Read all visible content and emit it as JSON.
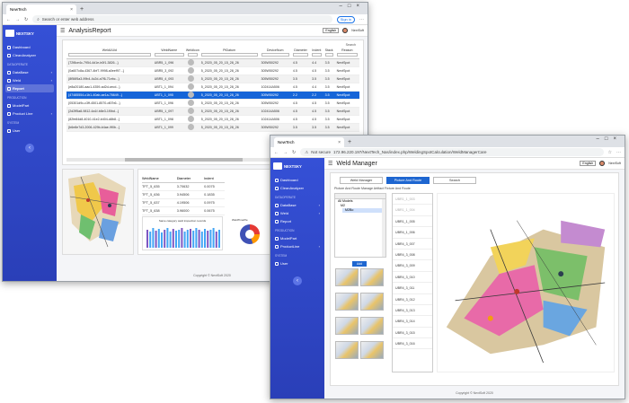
{
  "window1": {
    "tab_title": "NewTech",
    "address": "Search or enter web address",
    "signin": "Sign in",
    "logo": "NEXTSKY",
    "sidebar": {
      "items": [
        {
          "label": "Dashboard"
        },
        {
          "label": "CleanAnalyzer"
        }
      ],
      "section1": "DATAOPERATE",
      "items2": [
        {
          "label": "DataBase"
        },
        {
          "label": "Weld"
        },
        {
          "label": "Report"
        }
      ],
      "section2": "PRODUCTION",
      "items3": [
        {
          "label": "ModelPart"
        },
        {
          "label": "Product Line"
        }
      ],
      "section3": "SYSTEM",
      "items4": [
        {
          "label": "User"
        }
      ]
    },
    "page_title": "AnalysisReport",
    "lang": "English",
    "user": "NextSoft",
    "search_label": "Search",
    "table": {
      "headers": [
        "WeldUUid",
        "WeldName",
        "WeldIcon",
        "PtDatum",
        "DeviceNum",
        "Diameter",
        "Indent",
        "Stack",
        "Reason"
      ],
      "rows": [
        [
          "{72f8ce4c-7954-4d1e-b0f1-3826...}",
          "UBR5_1_096",
          "",
          "5_2020_05_20_15_28_26",
          "305W50292",
          "4.5",
          "4.4",
          "3.5",
          "NextSpot"
        ],
        [
          "{0a607c8a-4367-4bf7-9998-a0eef97...}",
          "UBR5_3_092",
          "",
          "5_2020_05_20_15_28_26",
          "305W50292",
          "4.5",
          "4.5",
          "3.5",
          "NextSpot"
        ],
        [
          "{8f56f5a3-99b4-4c2d-a7f6-71ebc...}",
          "UBR5_4_093",
          "",
          "5_2020_05_20_15_28_26",
          "305W50292",
          "3.5",
          "3.5",
          "3.5",
          "NextSpot"
        ],
        [
          "{e8a20180-aac1-4359-ad2d-cecd...}",
          "UBT1_1_094",
          "",
          "5_2020_05_20_15_28_26",
          "102414A506",
          "4.5",
          "4.4",
          "3.5",
          "NextSpot"
        ],
        [
          "{47485554-c1b1-40ab-ae1a-76649...}",
          "UBT1_1_095",
          "",
          "5_2020_05_20_15_28_26",
          "305W50292",
          "2.2",
          "2.2",
          "3.5",
          "NextSpot"
        ],
        [
          "{05301d9c-c3ff-4501-8570-d67b6...}",
          "UBT1_1_096",
          "",
          "5_2020_05_20_15_28_26",
          "305W50292",
          "4.5",
          "4.5",
          "3.5",
          "NextSpot"
        ],
        [
          "{2d2ff5a8-9812-4a1f-b8e3-1f0bd...}",
          "UBR5_1_097",
          "",
          "5_2020_05_20_15_28_26",
          "102414A506",
          "4.5",
          "4.5",
          "3.5",
          "NextSpot"
        ],
        [
          "{82fe84d8-4010-41e2-b404-d8b8...}",
          "UBT1_1_098",
          "",
          "5_2020_05_20_15_28_26",
          "102414A506",
          "4.5",
          "4.5",
          "3.5",
          "NextSpot"
        ],
        [
          "{b6e8e7d3-2006-429b-b4ae-9f0b...}",
          "UBT1_1_099",
          "",
          "5_2020_05_20_15_28_26",
          "305W50292",
          "3.5",
          "3.5",
          "3.5",
          "NextSpot"
        ]
      ]
    },
    "mini_table": {
      "headers": [
        "WeldName",
        "Diameter",
        "Indent"
      ],
      "rows": [
        [
          "TFT_5_635",
          "3.70632",
          "0.0075"
        ],
        [
          "TFT_5_636",
          "3.94506",
          "0.1835"
        ],
        [
          "TFT_5_637",
          "4.19506",
          "0.0975"
        ],
        [
          "TFT_5_638",
          "3.96000",
          "0.0675"
        ]
      ]
    },
    "bar_title": "Same category weld inspection records",
    "donut_label": "WeldTimePie",
    "chart_title": "Same weld history",
    "footer": "Copyright © NextSoft 2020"
  },
  "window2": {
    "tab_title": "NewTech",
    "address": "172.96.220.197/NextTech_Nas/index.php/WeldingSpotCalculation/WeldManagerCare",
    "not_secure": "Not secure",
    "logo": "NEXTSKY",
    "page_title": "Weld Manager",
    "lang": "English",
    "user": "NextSoft",
    "tabs": [
      "Weld Manager",
      "Picture And Route",
      "Search"
    ],
    "crumb": "Picture And Route   Manage Artifact Fixture And Route",
    "tree": [
      "All Models",
      "M2",
      "M2Bo"
    ],
    "add_label": "Add",
    "welds": [
      "UBR1_1_003",
      "UBR1_1_004",
      "UBR1_1_005",
      "UBR4_1_006",
      "UBR4_3_007",
      "UBR4_3_008",
      "UBR4_3_009",
      "UBR4_3_010",
      "UBR4_3_011",
      "UBR4_3_012",
      "UBR4_3_013",
      "UBR4_3_014",
      "UBR4_3_015",
      "UBR4_3_016"
    ],
    "footer": "Copyright © NextSoft 2020",
    "sidebar": {
      "items": [
        {
          "label": "Dashboard"
        },
        {
          "label": "CleanAnalyzer"
        }
      ],
      "section1": "DATAOPERATE",
      "items2": [
        {
          "label": "DataBase"
        },
        {
          "label": "Weld"
        },
        {
          "label": "Report"
        }
      ],
      "section2": "PRODUCTION",
      "items3": [
        {
          "label": "ModelPart"
        },
        {
          "label": "ProductLine"
        }
      ],
      "section3": "SYSTEM",
      "items4": [
        {
          "label": "User"
        }
      ]
    }
  }
}
